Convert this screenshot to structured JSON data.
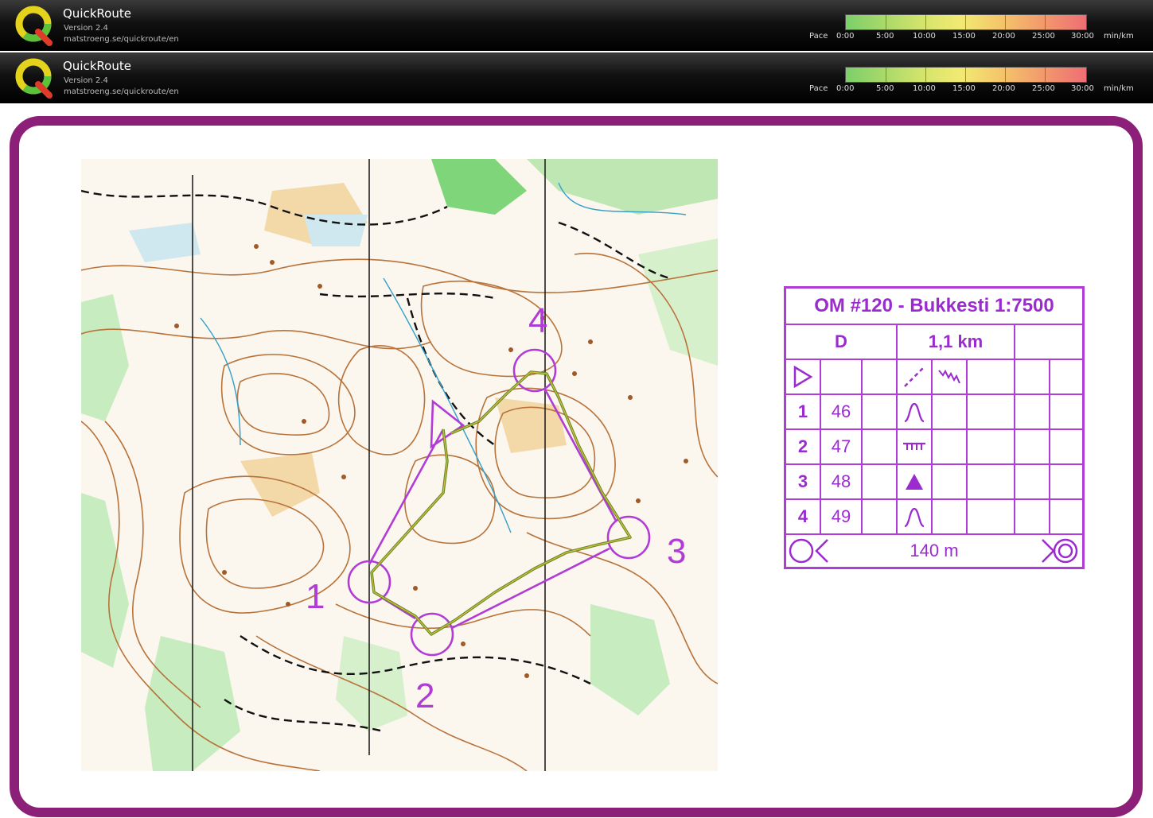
{
  "window_bars": [
    {
      "title": "QuickRoute",
      "version": "Version 2.4",
      "url": "matstroeng.se/quickroute/en",
      "pace_label": "Pace",
      "pace_ticks": [
        "0:00",
        "5:00",
        "10:00",
        "15:00",
        "20:00",
        "25:00",
        "30:00"
      ],
      "pace_unit": "min/km"
    },
    {
      "title": "QuickRoute",
      "version": "Version 2.4",
      "url": "matstroeng.se/quickroute/en",
      "pace_label": "Pace",
      "pace_ticks": [
        "0:00",
        "5:00",
        "10:00",
        "15:00",
        "20:00",
        "25:00",
        "30:00"
      ],
      "pace_unit": "min/km"
    }
  ],
  "map": {
    "controls": [
      "1",
      "2",
      "3",
      "4"
    ],
    "colors": {
      "course": "#b13bd6",
      "route": "#5a7a2a",
      "frame": "#8c1f78"
    }
  },
  "description": {
    "title": "OM #120 - Bukkesti 1:7500",
    "class": "D",
    "length": "1,1 km",
    "controls": [
      {
        "num": "1",
        "code": "46",
        "symbol": "knoll"
      },
      {
        "num": "2",
        "code": "47",
        "symbol": "earth-bank"
      },
      {
        "num": "3",
        "code": "48",
        "symbol": "boulder"
      },
      {
        "num": "4",
        "code": "49",
        "symbol": "knoll"
      }
    ],
    "finish": "140 m"
  }
}
